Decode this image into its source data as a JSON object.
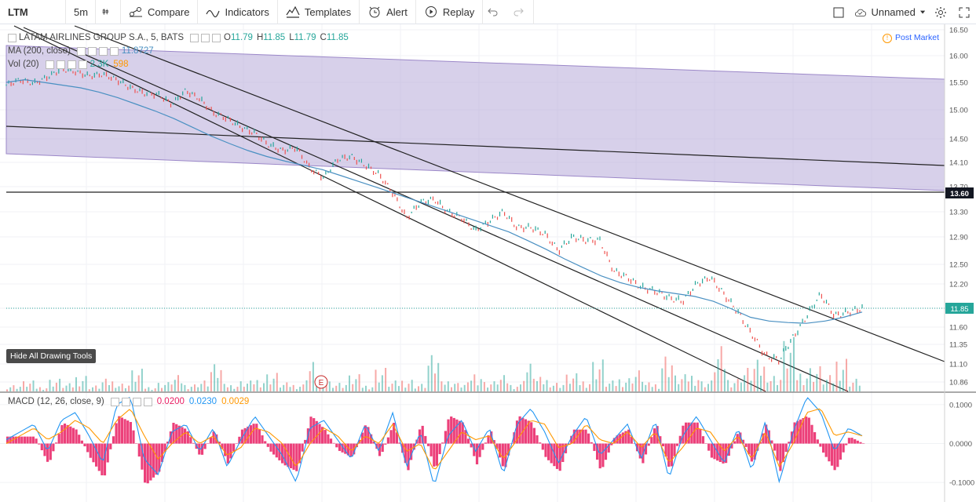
{
  "toolbar": {
    "symbol": "LTM",
    "interval": "5m",
    "compare": "Compare",
    "indicators": "Indicators",
    "templates": "Templates",
    "alert": "Alert",
    "replay": "Replay",
    "layout_name": "Unnamed"
  },
  "legend": {
    "title": "LATAM AIRLINES GROUP S.A., 5, BATS",
    "o_label": "O",
    "o_val": "11.79",
    "h_label": "H",
    "h_val": "11.85",
    "l_label": "L",
    "l_val": "11.79",
    "c_label": "C",
    "c_val": "11.85",
    "ma_label": "MA (200, close)",
    "ma_val": "11.8727",
    "vol_label": "Vol (20)",
    "vol_val1": "2.3K",
    "vol_val2": "598"
  },
  "macd_legend": {
    "label": "MACD (12, 26, close, 9)",
    "v1": "0.0200",
    "v2": "0.0230",
    "v3": "0.0029"
  },
  "post_market": "Post Market",
  "hide_tools": "Hide All Drawing Tools",
  "earnings_marker": "E",
  "colors": {
    "up": "#26a69a",
    "down": "#ef5350",
    "ma": "#4a90c2",
    "channel": "#b7a9d8",
    "macd_line": "#2196f3",
    "signal_line": "#ff9800",
    "hist": "#e91e63"
  },
  "chart_data": [
    {
      "type": "line",
      "title": "LATAM AIRLINES GROUP S.A., 5, BATS",
      "y_ticks": [
        "16.50",
        "16.00",
        "15.50",
        "15.00",
        "14.50",
        "14.10",
        "13.70",
        "13.30",
        "12.90",
        "12.50",
        "12.20",
        "11.85",
        "11.60",
        "11.35",
        "11.10",
        "10.86"
      ],
      "ylim": [
        10.7,
        16.5
      ],
      "last_price": 11.85,
      "horizontal_line": 13.6,
      "price_path": [
        15.45,
        15.55,
        15.48,
        15.6,
        15.75,
        15.7,
        15.62,
        15.65,
        15.55,
        15.4,
        15.3,
        15.28,
        15.1,
        15.35,
        15.2,
        14.95,
        14.85,
        14.7,
        14.6,
        14.4,
        14.3,
        14.35,
        14.0,
        13.85,
        14.15,
        14.2,
        14.05,
        13.9,
        13.6,
        13.2,
        13.45,
        13.5,
        13.3,
        13.2,
        13.0,
        13.15,
        13.3,
        13.05,
        13.05,
        12.95,
        12.7,
        12.9,
        12.85,
        12.85,
        12.4,
        12.3,
        12.15,
        12.1,
        12.0,
        11.95,
        12.2,
        12.3,
        12.05,
        11.8,
        11.5,
        11.2,
        11.15,
        11.45,
        11.75,
        12.05,
        11.75,
        11.8,
        11.85
      ],
      "ma_path": [
        15.5,
        15.55,
        15.5,
        15.45,
        15.4,
        15.32,
        15.22,
        15.1,
        14.98,
        14.85,
        14.7,
        14.55,
        14.42,
        14.3,
        14.2,
        14.12,
        14.05,
        13.98,
        13.88,
        13.78,
        13.68,
        13.58,
        13.48,
        13.38,
        13.28,
        13.18,
        13.08,
        12.98,
        12.85,
        12.72,
        12.58,
        12.45,
        12.32,
        12.22,
        12.15,
        12.1,
        12.06,
        12.02,
        11.95,
        11.84,
        11.73,
        11.68,
        11.66,
        11.65,
        11.68,
        11.73,
        11.8
      ]
    },
    {
      "type": "bar",
      "title": "Vol (20)",
      "values": [
        8,
        12,
        6,
        15,
        9,
        20,
        7,
        14,
        10,
        25,
        6,
        11,
        18,
        9,
        13,
        30,
        8,
        12,
        16,
        22,
        10,
        9,
        35,
        14,
        11,
        19,
        8,
        28,
        12,
        15,
        9,
        40,
        13,
        10,
        24,
        12,
        18,
        9,
        33,
        16,
        11,
        20,
        14,
        38,
        12,
        17,
        25,
        10,
        45,
        19,
        22,
        13,
        50,
        16,
        28,
        35,
        20,
        60,
        25,
        30,
        18,
        42,
        15
      ]
    },
    {
      "type": "line",
      "title": "MACD (12, 26, close, 9)",
      "y_ticks": [
        "0.1000",
        "0.0000",
        "-0.1000"
      ],
      "ylim": [
        -0.15,
        0.13
      ],
      "macd": [
        0.01,
        0.03,
        0.05,
        -0.02,
        0.06,
        0.08,
        0.02,
        -0.05,
        0.1,
        0.12,
        -0.04,
        -0.08,
        0.03,
        0.05,
        -0.02,
        0.04,
        -0.06,
        0.01,
        0.07,
        0.02,
        -0.03,
        -0.1,
        0.04,
        0.06,
        0.01,
        -0.04,
        0.05,
        -0.02,
        0.08,
        -0.06,
        0.03,
        -0.11,
        0.02,
        0.06,
        -0.02,
        0.04,
        -0.08,
        0.05,
        0.09,
        0.03,
        -0.05,
        0.02,
        0.07,
        -0.03,
        0.01,
        0.05,
        -0.04,
        0.06,
        -0.09,
        0.02,
        0.07,
        0.01,
        -0.05,
        0.04,
        -0.07,
        0.06,
        -0.1,
        0.03,
        0.12,
        0.08,
        -0.02,
        0.04,
        0.02
      ],
      "signal": [
        0.0,
        0.02,
        0.04,
        0.01,
        0.03,
        0.06,
        0.04,
        0.0,
        0.06,
        0.09,
        0.02,
        -0.04,
        0.0,
        0.03,
        0.0,
        0.02,
        -0.03,
        -0.01,
        0.04,
        0.03,
        0.0,
        -0.06,
        0.0,
        0.04,
        0.02,
        -0.02,
        0.02,
        0.0,
        0.05,
        -0.02,
        0.0,
        -0.07,
        -0.02,
        0.03,
        0.01,
        0.02,
        -0.04,
        0.01,
        0.06,
        0.05,
        -0.01,
        0.0,
        0.05,
        0.01,
        0.0,
        0.03,
        -0.01,
        0.03,
        -0.05,
        -0.01,
        0.04,
        0.03,
        -0.02,
        0.02,
        -0.04,
        0.03,
        -0.06,
        0.0,
        0.08,
        0.09,
        0.02,
        0.03,
        0.02
      ]
    }
  ]
}
